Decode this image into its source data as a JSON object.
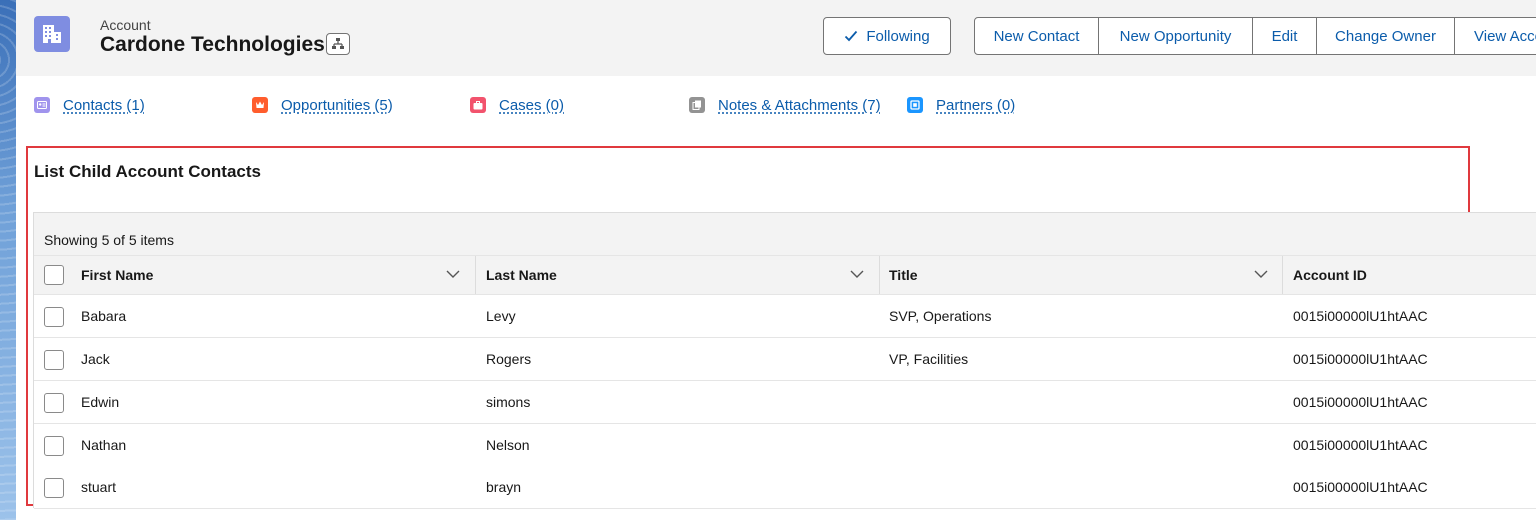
{
  "header": {
    "object_label": "Account",
    "record_name": "Cardone Technologies",
    "actions": {
      "following": "Following",
      "new_contact": "New Contact",
      "new_opportunity": "New Opportunity",
      "edit": "Edit",
      "change_owner": "Change Owner",
      "view_account": "View Acco"
    }
  },
  "related_links": [
    {
      "label": "Contacts (1)",
      "icon": "contact-icon",
      "color": "#a094ed"
    },
    {
      "label": "Opportunities (5)",
      "icon": "opportunity-icon",
      "color": "#ff5d2d"
    },
    {
      "label": "Cases (0)",
      "icon": "case-icon",
      "color": "#f2536d"
    },
    {
      "label": "Notes & Attachments (7)",
      "icon": "notes-icon",
      "color": "#939393"
    },
    {
      "label": "Partners (0)",
      "icon": "partner-icon",
      "color": "#1b96ff"
    }
  ],
  "panel": {
    "title": "List Child Account Contacts",
    "caption": "Showing 5 of 5 items",
    "columns": [
      "First Name",
      "Last Name",
      "Title",
      "Account ID"
    ],
    "rows": [
      {
        "first_name": "Babara",
        "last_name": "Levy",
        "title": "SVP, Operations",
        "account_id": "0015i00000lU1htAAC"
      },
      {
        "first_name": "Jack",
        "last_name": "Rogers",
        "title": "VP, Facilities",
        "account_id": "0015i00000lU1htAAC"
      },
      {
        "first_name": "Edwin",
        "last_name": "simons",
        "title": "",
        "account_id": "0015i00000lU1htAAC"
      },
      {
        "first_name": "Nathan",
        "last_name": "Nelson",
        "title": "",
        "account_id": "0015i00000lU1htAAC"
      },
      {
        "first_name": "stuart",
        "last_name": "brayn",
        "title": "",
        "account_id": "0015i00000lU1htAAC"
      }
    ]
  },
  "colors": {
    "brand_blue": "#0b5cab",
    "account_icon": "#7f8de1",
    "highlight_border": "#e0393e"
  }
}
